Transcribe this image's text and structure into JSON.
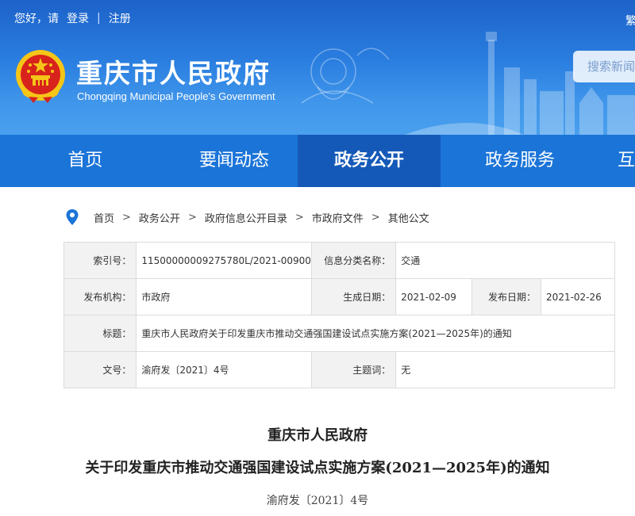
{
  "header": {
    "greeting": "您好，请",
    "login": "登录",
    "separator": "|",
    "register": "注册",
    "site_title": "重庆市人民政府",
    "site_subtitle": "Chongqing Municipal People's Government",
    "search_placeholder": "搜索新闻",
    "clipped_text": "繁"
  },
  "nav": {
    "items": [
      {
        "label": "首页"
      },
      {
        "label": "要闻动态"
      },
      {
        "label": "政务公开"
      },
      {
        "label": "政务服务"
      },
      {
        "label": "互"
      }
    ],
    "active_index": 2
  },
  "breadcrumb": {
    "items": [
      "首页",
      "政务公开",
      "政府信息公开目录",
      "市政府文件",
      "其他公文"
    ],
    "arrow": ">"
  },
  "info": {
    "index_label": "索引号：",
    "index_value": "11500000009275780L/2021-00900",
    "category_label": "信息分类名称：",
    "category_value": "交通",
    "publisher_label": "发布机构：",
    "publisher_value": "市政府",
    "created_label": "生成日期：",
    "created_value": "2021-02-09",
    "published_label": "发布日期：",
    "published_value": "2021-02-26",
    "title_label": "标题：",
    "title_value": "重庆市人民政府关于印发重庆市推动交通强国建设试点实施方案(2021—2025年)的通知",
    "docno_label": "文号：",
    "docno_value": "渝府发〔2021〕4号",
    "subject_label": "主题词：",
    "subject_value": "无"
  },
  "document": {
    "issuer": "重庆市人民政府",
    "title": "关于印发重庆市推动交通强国建设试点实施方案(2021—2025年)的通知",
    "number": "渝府发〔2021〕4号"
  },
  "colors": {
    "header_blue": "#2a7ee0",
    "nav_blue": "#1b74d8",
    "nav_active": "#1559b8",
    "emblem_red": "#d8231c",
    "emblem_gold": "#f5c518"
  }
}
